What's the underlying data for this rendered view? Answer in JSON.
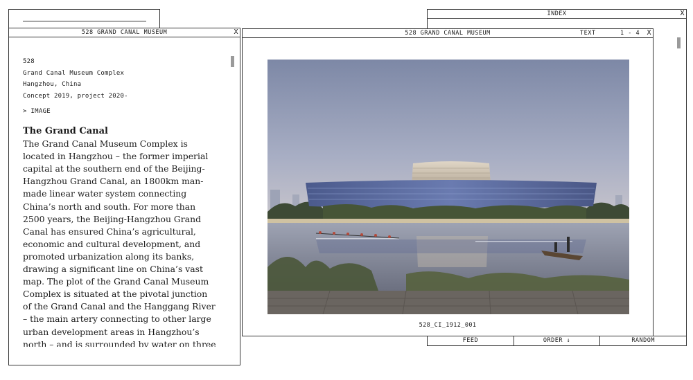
{
  "text_window": {
    "title": "528 GRAND CANAL MUSEUM",
    "close_label": "X",
    "meta": [
      "528",
      "Grand Canal Museum Complex",
      "Hangzhou, China",
      "Concept 2019, project 2020-"
    ],
    "image_link": "> IMAGE",
    "heading": "The Grand Canal",
    "body": "The Grand Canal Museum Complex is located in Hangzhou – the former imperial capital at the southern end of the Beijing-Hangzhou Grand Canal, an 1800km man-made linear water system connecting China’s north and south. For more than 2500 years, the Beijing-Hangzhou Grand Canal has ensured China’s agricultural, economic and cultural development, and promoted urbanization along its banks, drawing a significant line on China’s vast map. The plot of the Grand Canal Museum Complex is situated at the pivotal junction of the Grand Canal and the Hanggang River – the main artery connecting to other large urban development areas in Hangzhou’s north – and is surrounded by water on three"
  },
  "image_window": {
    "title": "528 GRAND CANAL MUSEUM",
    "mode_label": "TEXT",
    "counter": "1 - 4",
    "close_label": "X",
    "caption": "528_CI_1912_001"
  },
  "index_window": {
    "title": "INDEX",
    "close_label": "X",
    "footer": [
      "FEED",
      "ORDER ↓",
      "RANDOM"
    ]
  },
  "colors": {
    "border": "#333333",
    "background": "#ffffff",
    "scrollbar": "#9a9a9a"
  }
}
